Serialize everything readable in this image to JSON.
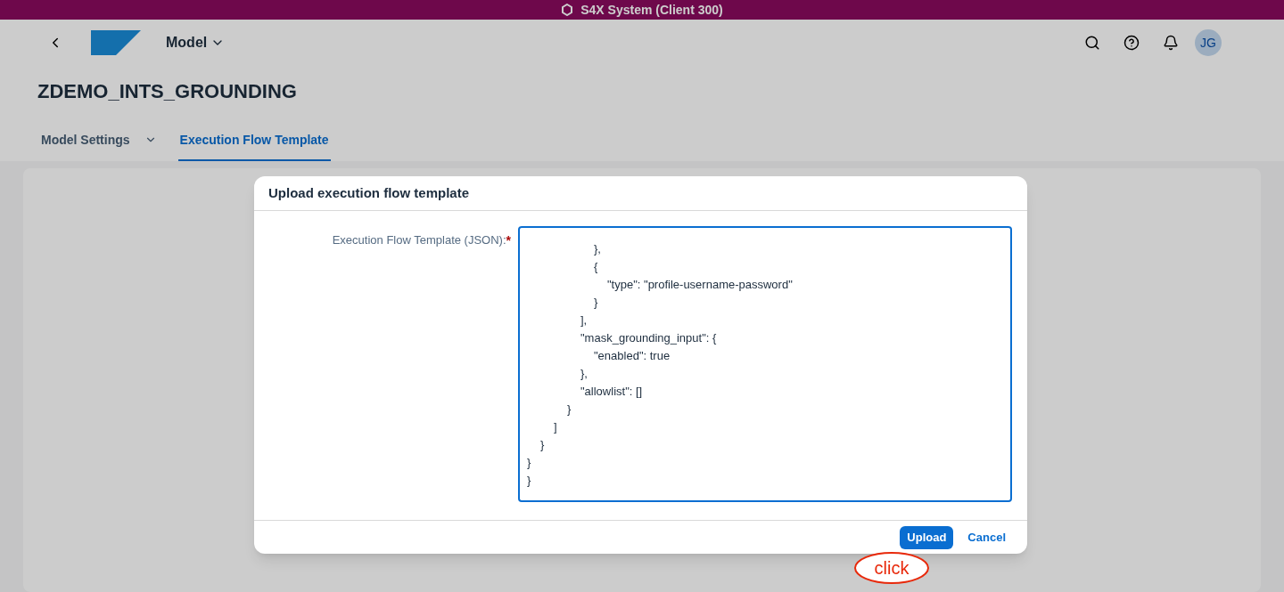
{
  "system_bar": {
    "title": "S4X System (Client 300)"
  },
  "shell": {
    "app_title": "Model",
    "avatar": "JG"
  },
  "page": {
    "title": "ZDEMO_INTS_GROUNDING"
  },
  "tabs": [
    {
      "label": "Model Settings",
      "selected": false,
      "has_menu": true
    },
    {
      "label": "Execution Flow Template",
      "selected": true,
      "has_menu": false
    }
  ],
  "dialog": {
    "title": "Upload execution flow template",
    "field_label": "Execution Flow Template (JSON):",
    "required_mark": "*",
    "value": "\t\t\t\t\t},\n\t\t\t\t\t{\n\t\t\t\t\t\t\"type\": \"profile-username-password\"\n\t\t\t\t\t}\n\t\t\t\t],\n\t\t\t\t\"mask_grounding_input\": {\n\t\t\t\t\t\"enabled\": true\n\t\t\t\t},\n\t\t\t\t\"allowlist\": []\n\t\t\t}\n\t\t]\n\t}\n}\n}",
    "buttons": [
      {
        "label": "Upload",
        "kind": "primary"
      },
      {
        "label": "Cancel",
        "kind": "transparent"
      }
    ]
  },
  "annotation": {
    "text": "click"
  }
}
